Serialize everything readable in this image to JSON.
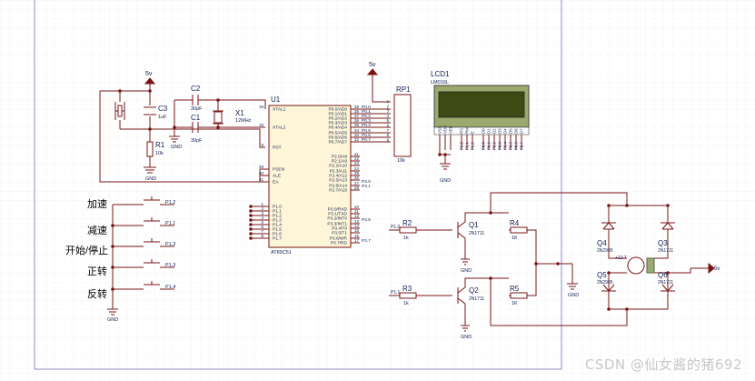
{
  "supply_labels": [
    "5v",
    "5v",
    "5v"
  ],
  "gnd_label": "GND",
  "mcu": {
    "ref": "U1",
    "part": "AT89C51",
    "left_pins": [
      {
        "num": "19",
        "name": "XTAL1"
      },
      {
        "num": "18",
        "name": "XTAL2"
      },
      {
        "num": "9",
        "name": "RST"
      },
      {
        "num": "29",
        "name": "PSEN"
      },
      {
        "num": "30",
        "name": "ALE"
      },
      {
        "num": "31",
        "name": "EA"
      },
      {
        "num": "1",
        "name": "P1.0"
      },
      {
        "num": "2",
        "name": "P1.1"
      },
      {
        "num": "3",
        "name": "P1.2"
      },
      {
        "num": "4",
        "name": "P1.3"
      },
      {
        "num": "5",
        "name": "P1.4"
      },
      {
        "num": "6",
        "name": "P1.5"
      },
      {
        "num": "7",
        "name": "P1.6"
      },
      {
        "num": "8",
        "name": "P1.7"
      }
    ],
    "right_pins": [
      {
        "num": "39",
        "name": "P0.0/AD0"
      },
      {
        "num": "38",
        "name": "P0.1/AD1"
      },
      {
        "num": "37",
        "name": "P0.2/AD2"
      },
      {
        "num": "36",
        "name": "P0.3/AD3"
      },
      {
        "num": "35",
        "name": "P0.4/AD4"
      },
      {
        "num": "34",
        "name": "P0.5/AD5"
      },
      {
        "num": "33",
        "name": "P0.6/AD6"
      },
      {
        "num": "32",
        "name": "P0.7/AD7"
      },
      {
        "num": "21",
        "name": "P2.0/A8"
      },
      {
        "num": "22",
        "name": "P2.1/A9"
      },
      {
        "num": "23",
        "name": "P2.2/A10"
      },
      {
        "num": "24",
        "name": "P2.3/A11"
      },
      {
        "num": "25",
        "name": "P2.4/A12"
      },
      {
        "num": "26",
        "name": "P2.5/A13"
      },
      {
        "num": "27",
        "name": "P2.6/A14"
      },
      {
        "num": "28",
        "name": "P2.7/A15"
      },
      {
        "num": "10",
        "name": "P3.0/RXD"
      },
      {
        "num": "11",
        "name": "P3.1/TXD"
      },
      {
        "num": "12",
        "name": "P3.2/INT0"
      },
      {
        "num": "13",
        "name": "P3.3/INT1"
      },
      {
        "num": "14",
        "name": "P3.4/T0"
      },
      {
        "num": "15",
        "name": "P3.5/T1"
      },
      {
        "num": "16",
        "name": "P3.6/WR"
      },
      {
        "num": "17",
        "name": "P3.7/RD"
      }
    ],
    "p0_net_labels": [
      "P0.0",
      "P0.1",
      "P0.2",
      "P0.3",
      "P0.4",
      "P0.5",
      "P0.6",
      "P0.7"
    ],
    "p3_net_labels": [
      "P3.0",
      "P3.1",
      "P3.5",
      "P3.7"
    ]
  },
  "components": {
    "c1": {
      "ref": "C1",
      "value": "30pF"
    },
    "c2": {
      "ref": "C2",
      "value": "30pF"
    },
    "c3": {
      "ref": "C3",
      "value": "1uF"
    },
    "x1": {
      "ref": "X1",
      "value": "12MHz"
    },
    "r1": {
      "ref": "R1",
      "value": "10k"
    },
    "rp1": {
      "ref": "RP1",
      "value": "10k",
      "pins": [
        "1",
        "2",
        "3",
        "4",
        "5",
        "6",
        "7",
        "8",
        "9"
      ]
    },
    "r2": {
      "ref": "R2",
      "value": "1k",
      "net": "P1.0"
    },
    "r3": {
      "ref": "R3",
      "value": "1k",
      "net": "P1.1"
    },
    "r4": {
      "ref": "R4",
      "value": "1K"
    },
    "r5": {
      "ref": "R5",
      "value": "1K"
    },
    "q1": {
      "ref": "Q1",
      "part": "2N1711"
    },
    "q2": {
      "ref": "Q2",
      "part": "2N1711"
    },
    "q3": {
      "ref": "Q3",
      "part": "2N1711"
    },
    "q4": {
      "ref": "Q4",
      "part": "2N2905"
    },
    "q5": {
      "ref": "Q5",
      "part": "2N2905"
    },
    "q6": {
      "ref": "Q6",
      "part": "2N1711"
    },
    "motor_label": "+12.7"
  },
  "lcd": {
    "ref": "LCD1",
    "part": "LM016L",
    "pins": [
      "VSS",
      "VDD",
      "VEE",
      "RS",
      "RW",
      "E",
      "D0",
      "D1",
      "D2",
      "D3",
      "D4",
      "D5",
      "D6",
      "D7"
    ],
    "net_labels": [
      "P2.0",
      "P2.1",
      "P2.2",
      "P0.0",
      "P0.1",
      "P0.2",
      "P0.3",
      "P0.4",
      "P0.5",
      "P0.6",
      "P0.7"
    ]
  },
  "buttons": [
    {
      "label": "加速",
      "net": "P1.2"
    },
    {
      "label": "减速",
      "net": "P1.1"
    },
    {
      "label": "开始/停止",
      "net": "P1.3"
    },
    {
      "label": "正转",
      "net": "P1.3"
    },
    {
      "label": "反转",
      "net": "P1.4"
    }
  ],
  "watermark": "CSDN @仙女酱的猪692"
}
